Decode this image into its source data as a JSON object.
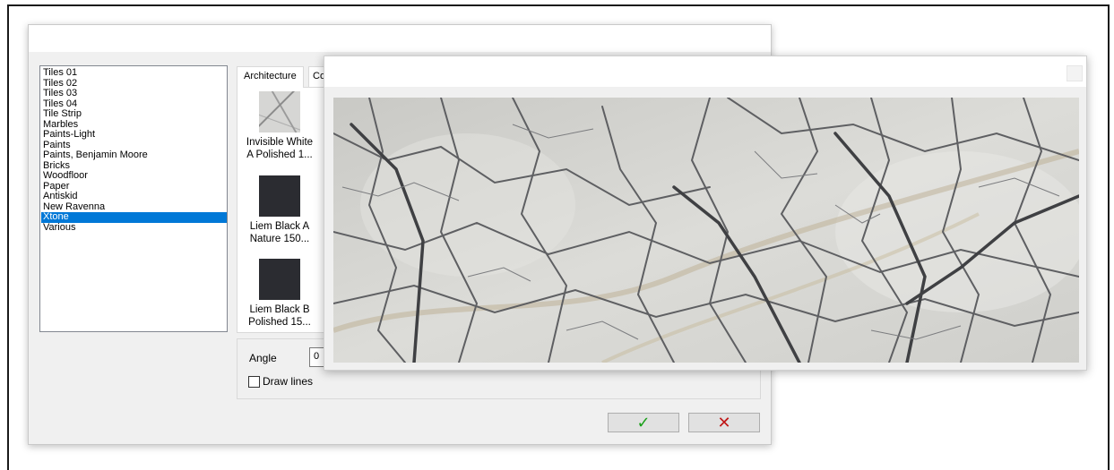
{
  "categories": [
    {
      "label": "Tiles 01"
    },
    {
      "label": "Tiles 02"
    },
    {
      "label": "Tiles 03"
    },
    {
      "label": "Tiles 04"
    },
    {
      "label": "Tile Strip"
    },
    {
      "label": "Marbles"
    },
    {
      "label": "Paints-Light"
    },
    {
      "label": "Paints"
    },
    {
      "label": "Paints, Benjamin Moore"
    },
    {
      "label": "Bricks"
    },
    {
      "label": "Woodfloor"
    },
    {
      "label": "Paper"
    },
    {
      "label": "Antiskid"
    },
    {
      "label": "New Ravenna"
    },
    {
      "label": "Xtone",
      "selected": true
    },
    {
      "label": "Various"
    }
  ],
  "tabs": [
    "Architecture",
    "Co"
  ],
  "materials": [
    {
      "caption_line1": "Invisible White",
      "caption_line2": "A Polished 1...",
      "thumb": "marble"
    },
    {
      "caption_line1": "Liem Black A",
      "caption_line2": "Nature 150...",
      "thumb": "black"
    },
    {
      "caption_line1": "Liem Black B",
      "caption_line2": "Polished 15...",
      "thumb": "black"
    }
  ],
  "options": {
    "angle_label": "Angle",
    "angle_value": "0",
    "draw_lines_label": "Draw lines",
    "draw_lines_checked": false
  },
  "buttons": {
    "ok_icon": "check-icon",
    "ok_glyph": "✓",
    "cancel_icon": "x-icon",
    "cancel_glyph": "✕"
  },
  "colors": {
    "selection": "#0078d7",
    "ok": "#19a019",
    "cancel": "#c01616"
  }
}
